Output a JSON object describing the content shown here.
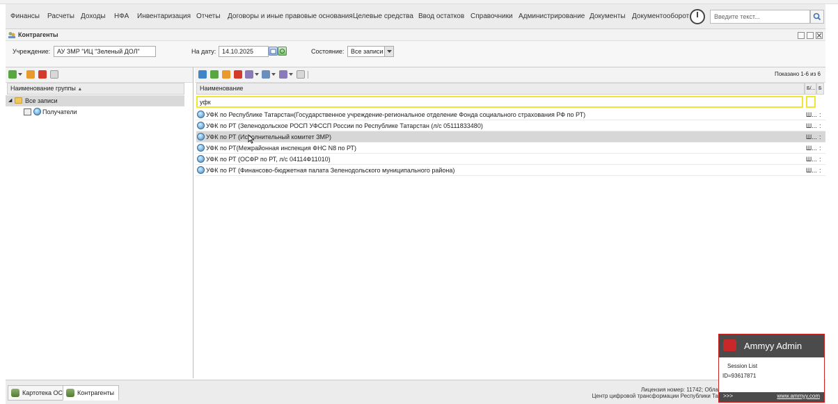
{
  "menu": {
    "items": [
      "Финансы",
      "Расчеты",
      "Доходы",
      "НФА",
      "Инвентаризация",
      "Отчеты",
      "Договоры и иные правовые основания",
      "Целевые средства",
      "Ввод остатков",
      "Справочники",
      "Администрирование",
      "Документы",
      "Документооборот"
    ],
    "search_placeholder": "Введите текст..."
  },
  "window": {
    "title": "Контрагенты"
  },
  "filters": {
    "institution_label": "Учреждение:",
    "institution_value": "АУ ЗМР \"ИЦ \"Зеленый ДОЛ\"",
    "date_label": "На дату:",
    "date_value": "14.10.2025",
    "state_label": "Состояние:",
    "state_value": "Все записи"
  },
  "tree": {
    "header": "Наименование группы",
    "items": [
      {
        "label": "Все записи",
        "selected": true
      },
      {
        "label": "Получатели",
        "selected": false
      }
    ]
  },
  "grid": {
    "shown_text": "Показано 1-6 из 6",
    "column_name": "Наименование",
    "column_2": "Б/...",
    "column_3": "Б",
    "filter_value": "уфк",
    "rows": [
      {
        "name": "УФК по Республике Татарстан(Государственное учреждение-региональное отделение Фонда социального страхования РФ по РТ)",
        "c2": "Ш...",
        "c3": ":"
      },
      {
        "name": "УФК по РТ (Зеленодольское РОСП УФССП России по Республике Татарстан (л/с 05111833480)",
        "c2": "Ш...",
        "c3": ":"
      },
      {
        "name": "УФК по РТ (Исполнительный комитет ЗМР)",
        "c2": "Ш...",
        "c3": ":"
      },
      {
        "name": "УФК по РТ(Межрайонная инспекция ФНС N8 по РТ)",
        "c2": "Ш...",
        "c3": ":"
      },
      {
        "name": "УФК по РТ (ОСФР по РТ, л/с 04114Ф11010)",
        "c2": "Ш...",
        "c3": ":"
      },
      {
        "name": "УФК по РТ (Финансово-бюджетная палата Зеленодольского муниципального района)",
        "c2": "Ш...",
        "c3": ":"
      }
    ],
    "selected_row": 2
  },
  "taskbar": {
    "tabs": [
      "Картотека ОС",
      "Контрагенты"
    ],
    "license_line1": "Лицензия номер: 11742; Обла",
    "license_line2": "Центр цифровой трансформации Республики Та"
  },
  "ammyy": {
    "title": "Ammyy Admin",
    "session_list": "Session List",
    "id": "ID=93617871",
    "more": ">>>",
    "link": "www.ammyy.com"
  }
}
